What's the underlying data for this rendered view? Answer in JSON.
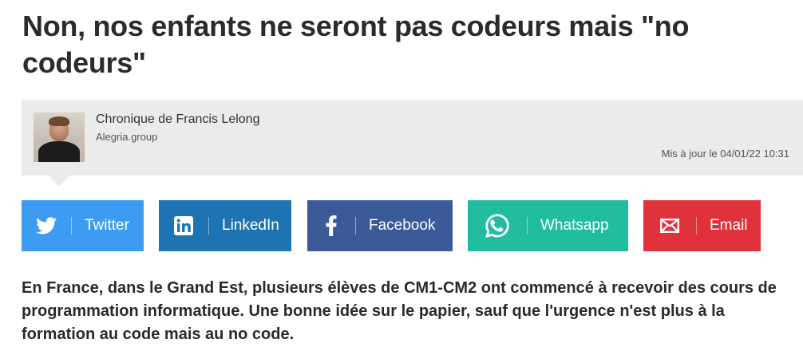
{
  "article": {
    "title": "Non, nos enfants ne seront pas codeurs mais \"no codeurs\"",
    "lead": "En France, dans le Grand Est, plusieurs élèves de CM1-CM2 ont commencé à recevoir des cours de programmation informatique. Une bonne idée sur le papier, sauf que l'urgence n'est plus à la formation au code mais au no code."
  },
  "author": {
    "name": "Chronique de Francis Lelong",
    "organization": "Alegria.group",
    "updated": "Mis à jour le 04/01/22 10:31"
  },
  "share": {
    "twitter": {
      "label": "Twitter",
      "icon": "twitter-icon",
      "color": "#3e9bf2"
    },
    "linkedin": {
      "label": "LinkedIn",
      "icon": "linkedin-icon",
      "color": "#1e73b2"
    },
    "facebook": {
      "label": "Facebook",
      "icon": "facebook-icon",
      "color": "#3a5a99"
    },
    "whatsapp": {
      "label": "Whatsapp",
      "icon": "whatsapp-icon",
      "color": "#22bd9f"
    },
    "email": {
      "label": "Email",
      "icon": "email-icon",
      "color": "#e0323a"
    }
  }
}
